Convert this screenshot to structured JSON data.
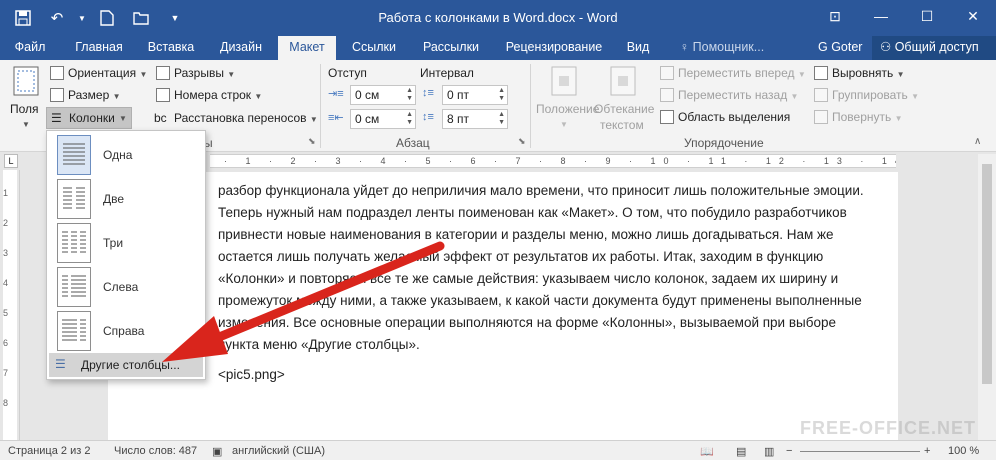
{
  "window": {
    "title": "Работа с колонками в Word.docx - Word",
    "controls": {
      "help": "?",
      "ribbon_options": "⊡",
      "minimize": "—",
      "maximize": "☐",
      "close": "✕"
    }
  },
  "qat": {
    "save_icon": "save-icon",
    "undo_icon": "undo-icon",
    "new_icon": "new-doc-icon",
    "open_icon": "open-icon",
    "more_icon": "customize-icon"
  },
  "tabs": [
    {
      "label": "Файл"
    },
    {
      "label": "Главная"
    },
    {
      "label": "Вставка"
    },
    {
      "label": "Дизайн"
    },
    {
      "label": "Макет"
    },
    {
      "label": "Ссылки"
    },
    {
      "label": "Рассылки"
    },
    {
      "label": "Рецензирование"
    },
    {
      "label": "Вид"
    },
    {
      "label": "Помощник..."
    }
  ],
  "user": "G Goter",
  "share": "Общий доступ",
  "ribbon": {
    "page_setup": {
      "margins": "Поля",
      "orientation": "Ориентация",
      "size": "Размер",
      "columns": "Колонки",
      "breaks": "Разрывы",
      "line_numbers": "Номера строк",
      "hyphenation": "Расстановка переносов",
      "label_partial": "ы"
    },
    "paragraph": {
      "indent": "Отступ",
      "spacing": "Интервал",
      "indent_left": "0 см",
      "indent_right": "0 см",
      "space_before": "0 пт",
      "space_after": "8 пт",
      "label": "Абзац"
    },
    "arrange": {
      "position_1": "Положение",
      "wrap_1": "Обтекание",
      "wrap_2": "текстом",
      "bring_forward": "Переместить вперед",
      "send_backward": "Переместить назад",
      "selection_pane": "Область выделения",
      "align": "Выровнять",
      "group": "Группировать",
      "rotate": "Повернуть",
      "label": "Упорядочение"
    }
  },
  "columns_menu": {
    "items": [
      {
        "label": "Одна"
      },
      {
        "label": "Две"
      },
      {
        "label": "Три"
      },
      {
        "label": "Слева"
      },
      {
        "label": "Справа"
      }
    ],
    "more": "Другие столбцы..."
  },
  "ruler_numbers": "· 1 · 2 · 3 · 4 · 5 · 6 · 7 · 8 · 9 · 10 · 11 · 12 · 13 · 14 · 15 · 16 · 17 ·",
  "vruler_numbers": [
    "1",
    "2",
    "3",
    "4",
    "5",
    "6",
    "7",
    "8"
  ],
  "document": {
    "paragraphs": [
      "разбор функционала уйдет до неприличия мало времени, что приносит лишь положительные эмоции. Теперь нужный нам подраздел ленты поименован как «Макет». О том, что побудило разработчиков привнести новые наименования в категории и разделы меню, можно лишь догадываться. Нам же остается лишь получать желаемый эффект от результатов их работы. Итак, заходим в функцию «Колонки» и повторяем все те же самые действия: указываем число колонок, задаем их ширину и промежуток между ними, а также указываем, к какой части документа будут применены выполненные изменения. Все основные операции выполняются на форме «Колонны», вызываемой при выборе пункта меню «Другие столбцы».",
      "<pic5.png>"
    ]
  },
  "status": {
    "page": "Страница 2 из 2",
    "words": "Число слов: 487",
    "language": "английский (США)",
    "zoom": "100 %"
  },
  "watermark": "FREE-OFFICE.NET",
  "colors": {
    "accent": "#2b579a",
    "arrow": "#d9251c"
  }
}
